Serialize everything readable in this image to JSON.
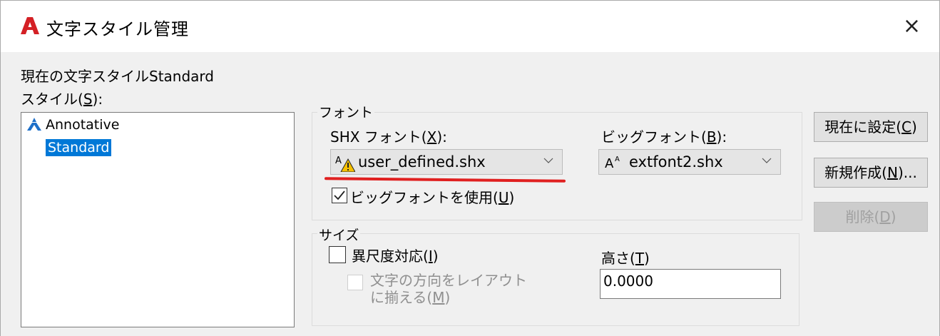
{
  "window": {
    "title": "文字スタイル管理",
    "close_symbol": "×"
  },
  "current_style": {
    "label": "現在の文字スタイル",
    "value": "Standard"
  },
  "styles": {
    "label_pre": "スタイル(",
    "label_key": "S",
    "label_post": "):",
    "items": [
      {
        "label": "Annotative",
        "icon": "annotative-icon",
        "selected": false
      },
      {
        "label": "Standard",
        "selected": true
      }
    ]
  },
  "font_group": {
    "title": "フォント",
    "shx": {
      "label_pre": "SHX フォント(",
      "label_key": "X",
      "label_post": "):",
      "value": "user_defined.shx",
      "icon": "shx-font-warning-icon"
    },
    "bigfont": {
      "label_pre": "ビッグフォント(",
      "label_key": "B",
      "label_post": "):",
      "value": "extfont2.shx",
      "icon": "bigfont-icon"
    },
    "use_bigfont": {
      "label_pre": "ビッグフォントを使用(",
      "label_key": "U",
      "label_post": ")",
      "checked": true
    }
  },
  "size_group": {
    "title": "サイズ",
    "annotative": {
      "label_pre": "異尺度対応(",
      "label_key": "I",
      "label_post": ")",
      "checked": false
    },
    "match_orientation": {
      "line1": "文字の方向をレイアウト",
      "line2_pre": "に揃える(",
      "line2_key": "M",
      "line2_post": ")",
      "checked": false,
      "enabled": false
    },
    "height": {
      "label_pre": "高さ(",
      "label_key": "T",
      "label_post": ")",
      "value": "0.0000"
    }
  },
  "buttons": {
    "set_current": {
      "pre": "現在に設定(",
      "key": "C",
      "post": ")"
    },
    "new": {
      "pre": "新規作成(",
      "key": "N",
      "post": ")..."
    },
    "delete": {
      "pre": "削除(",
      "key": "D",
      "post": ")",
      "enabled": false
    }
  },
  "colors": {
    "selection": "#0078d7",
    "annotation_underline": "#e02020",
    "logo_red": "#d42025",
    "warning_yellow": "#f5c000"
  }
}
